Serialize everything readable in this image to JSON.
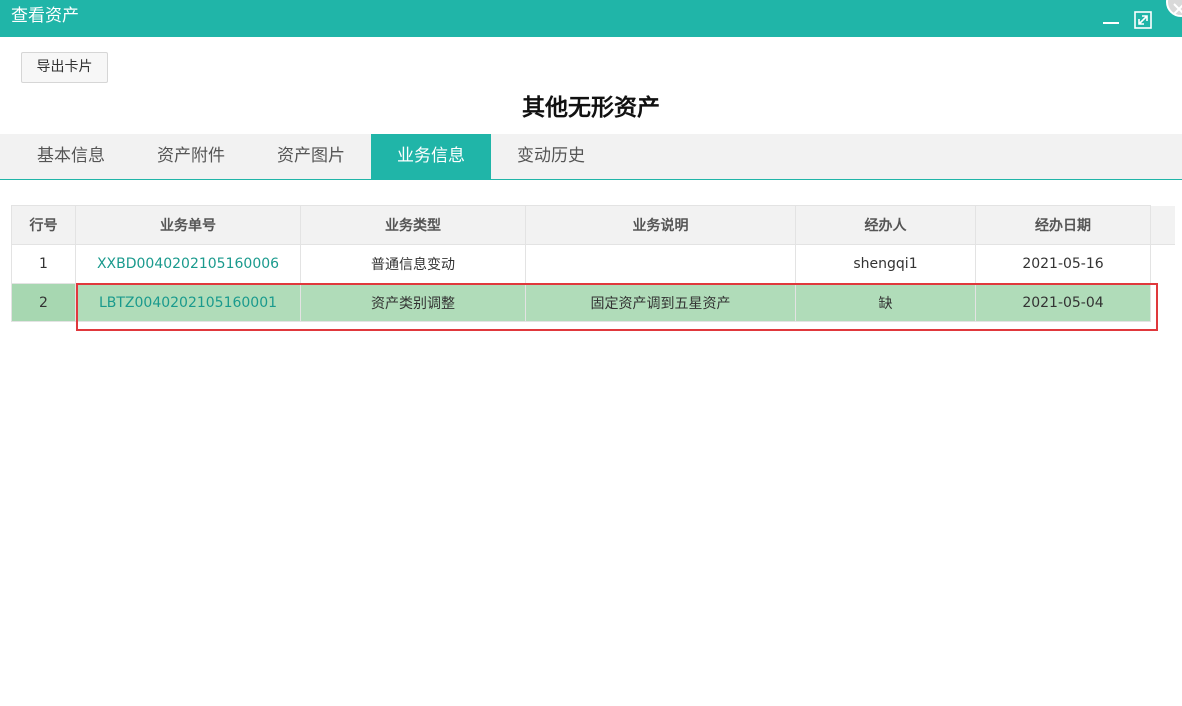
{
  "window": {
    "title": "查看资产"
  },
  "toolbar": {
    "export_label": "导出卡片"
  },
  "page": {
    "title": "其他无形资产"
  },
  "tabs": [
    {
      "label": "基本信息",
      "active": false
    },
    {
      "label": "资产附件",
      "active": false
    },
    {
      "label": "资产图片",
      "active": false
    },
    {
      "label": "业务信息",
      "active": true
    },
    {
      "label": "变动历史",
      "active": false
    }
  ],
  "table": {
    "columns": [
      "行号",
      "业务单号",
      "业务类型",
      "业务说明",
      "经办人",
      "经办日期"
    ],
    "rows": [
      {
        "row_no": "1",
        "doc_no": "XXBD0040202105160006",
        "type": "普通信息变动",
        "desc": "",
        "handler": "shengqi1",
        "date": "2021-05-16",
        "selected": false
      },
      {
        "row_no": "2",
        "doc_no": "LBTZ0040202105160001",
        "type": "资产类别调整",
        "desc": "固定资产调到五星资产",
        "handler": "缺",
        "date": "2021-05-04",
        "selected": true
      }
    ]
  },
  "icons": {
    "minimize": "minimize-icon",
    "maximize": "maximize-icon",
    "close": "close-icon"
  },
  "colors": {
    "accent": "#20b5a8",
    "selected_row": "#b0dcb9",
    "link": "#1a9a8d",
    "highlight_border": "#e0383c"
  }
}
